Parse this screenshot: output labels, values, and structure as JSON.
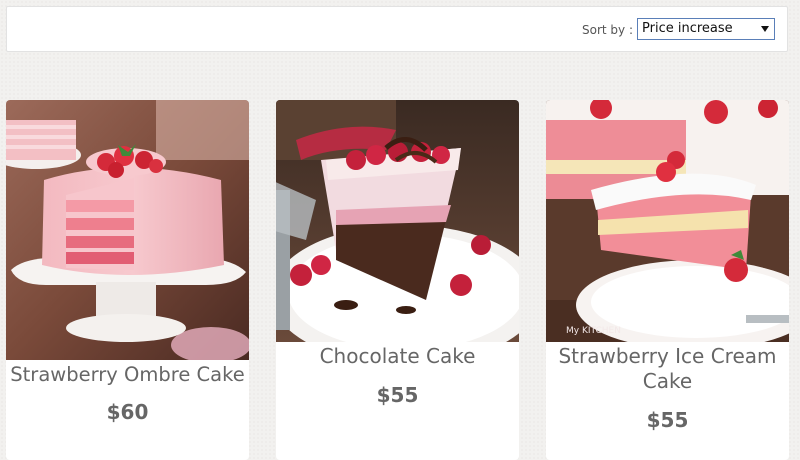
{
  "sort": {
    "label": "Sort by :",
    "selected": "Price increase"
  },
  "products": [
    {
      "name": "Strawberry Ombre Cake",
      "price": "$60"
    },
    {
      "name": "Chocolate Cake",
      "price": "$55"
    },
    {
      "name": "Strawberry Ice Cream Cake",
      "price": "$55"
    }
  ],
  "colors": {
    "page_bg": "#f2f1ef",
    "card_bg": "#ffffff",
    "text": "#666666",
    "select_border": "#5a7fb8"
  }
}
